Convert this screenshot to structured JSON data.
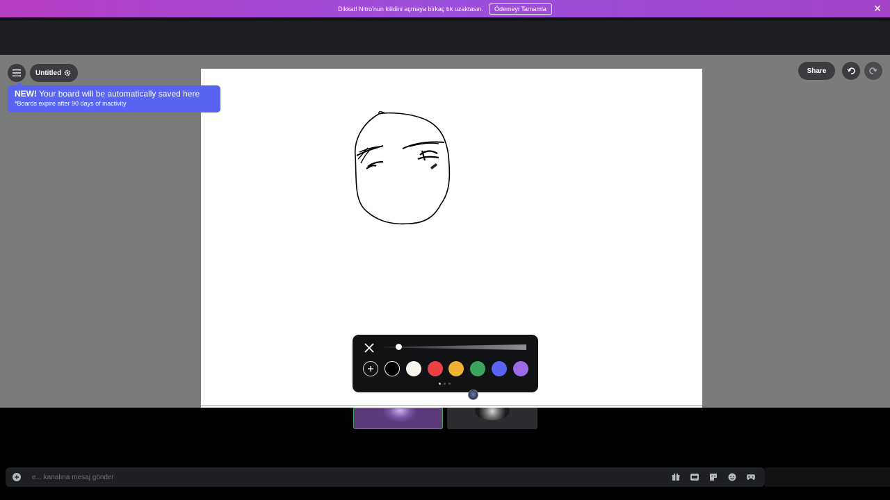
{
  "banner": {
    "text": "Dikkat! Nitro'nun kilidini açmaya birkaç tık uzaktasın.",
    "button_label": "Ödemeyi Tamamla",
    "close_glyph": "✕"
  },
  "board": {
    "title": "Untitled",
    "tooltip_bold": "NEW!",
    "tooltip_text": " Your board will be automatically saved here",
    "tooltip_note": "*Boards expire after 90 days of inactivity",
    "share_label": "Share"
  },
  "toolbar": {
    "stroke_size": 0.1,
    "colors": [
      "#000000",
      "#f7f4ec",
      "#ed4245",
      "#f0b232",
      "#3ba55d",
      "#5865f2",
      "#9b6ae4"
    ],
    "selected_color_index": 0,
    "page_indicator": {
      "current": 1,
      "total": 3
    }
  },
  "message": {
    "placeholder": "e... kanalına mesaj gönder"
  },
  "icons": {
    "menu": "hamburger-icon",
    "settings": "gear-icon",
    "undo": "undo-icon",
    "redo": "redo-icon",
    "close": "close-icon",
    "add_color": "plus-icon",
    "message_icons": [
      "gift-icon",
      "gif-icon",
      "sticker-icon",
      "emoji-icon",
      "activity-icon"
    ]
  },
  "colors": {
    "banner_start": "#b83fc4",
    "banner_end": "#9b4fdc",
    "tooltip": "#5865f2",
    "pill": "#3b3c3f",
    "stage": "#7a7b7b",
    "active_speaker": "#3ba55d"
  }
}
